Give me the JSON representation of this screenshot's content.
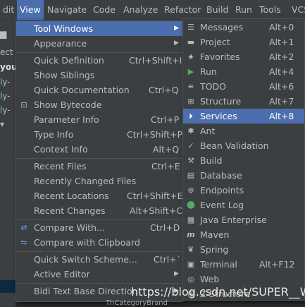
{
  "menubar": {
    "items": [
      {
        "label": "dit",
        "active": false
      },
      {
        "label": "View",
        "active": true
      },
      {
        "label": "Navigate",
        "active": false
      },
      {
        "label": "Code",
        "active": false
      },
      {
        "label": "Analyze",
        "active": false
      },
      {
        "label": "Refactor",
        "active": false
      },
      {
        "label": "Build",
        "active": false
      },
      {
        "label": "Run",
        "active": false
      },
      {
        "label": "Tools",
        "active": false
      },
      {
        "label": "VCS",
        "active": false
      }
    ]
  },
  "leftpane": {
    "texts": [
      "ect",
      "you",
      "ly-",
      "ly-",
      "ly-"
    ]
  },
  "view_menu": {
    "items": [
      {
        "label": "Tool Windows",
        "shortcut": "",
        "submenu": true,
        "selected": true
      },
      {
        "label": "Appearance",
        "shortcut": "",
        "submenu": true
      },
      {
        "sep": true
      },
      {
        "label": "Quick Definition",
        "shortcut": "Ctrl+Shift+I"
      },
      {
        "label": "Show Siblings",
        "shortcut": ""
      },
      {
        "label": "Quick Documentation",
        "shortcut": "Ctrl+Q"
      },
      {
        "label": "Show Bytecode",
        "shortcut": "",
        "icon": "bytecode-icon"
      },
      {
        "label": "Parameter Info",
        "shortcut": "Ctrl+P"
      },
      {
        "label": "Type Info",
        "shortcut": "Ctrl+Shift+P"
      },
      {
        "label": "Context Info",
        "shortcut": "Alt+Q"
      },
      {
        "sep": true
      },
      {
        "label": "Recent Files",
        "shortcut": "Ctrl+E"
      },
      {
        "label": "Recently Changed Files",
        "shortcut": ""
      },
      {
        "label": "Recent Locations",
        "shortcut": "Ctrl+Shift+E"
      },
      {
        "label": "Recent Changes",
        "shortcut": "Alt+Shift+C"
      },
      {
        "sep": true
      },
      {
        "label": "Compare With...",
        "shortcut": "Ctrl+D",
        "icon": "compare-icon"
      },
      {
        "label": "Compare with Clipboard",
        "shortcut": "",
        "icon": "compare-clipboard-icon"
      },
      {
        "sep": true
      },
      {
        "label": "Quick Switch Scheme...",
        "shortcut": "Ctrl+`"
      },
      {
        "label": "Active Editor",
        "shortcut": "",
        "submenu": true
      },
      {
        "sep": true
      },
      {
        "label": "Bidi Text Base Direction",
        "shortcut": "",
        "submenu": true
      }
    ]
  },
  "tool_windows_menu": {
    "items": [
      {
        "label": "Messages",
        "shortcut": "Alt+0",
        "icon": "messages-icon"
      },
      {
        "label": "Project",
        "shortcut": "Alt+1",
        "icon": "folder-icon"
      },
      {
        "label": "Favorites",
        "shortcut": "Alt+2",
        "icon": "star-icon"
      },
      {
        "label": "Run",
        "shortcut": "Alt+4",
        "icon": "run-icon"
      },
      {
        "label": "TODO",
        "shortcut": "Alt+6",
        "icon": "todo-icon"
      },
      {
        "label": "Structure",
        "shortcut": "Alt+7",
        "icon": "structure-icon"
      },
      {
        "label": "Services",
        "shortcut": "Alt+8",
        "icon": "services-icon",
        "selected": true
      },
      {
        "label": "Ant",
        "shortcut": "",
        "icon": "ant-icon"
      },
      {
        "label": "Bean Validation",
        "shortcut": "",
        "icon": "bean-validation-icon"
      },
      {
        "label": "Build",
        "shortcut": "",
        "icon": "hammer-icon"
      },
      {
        "label": "Database",
        "shortcut": "",
        "icon": "database-icon"
      },
      {
        "label": "Endpoints",
        "shortcut": "",
        "icon": "endpoints-icon"
      },
      {
        "label": "Event Log",
        "shortcut": "",
        "icon": "event-log-icon"
      },
      {
        "label": "Java Enterprise",
        "shortcut": "",
        "icon": "java-enterprise-icon"
      },
      {
        "label": "Maven",
        "shortcut": "",
        "icon": "maven-icon"
      },
      {
        "label": "Spring",
        "shortcut": "",
        "icon": "spring-icon"
      },
      {
        "label": "Terminal",
        "shortcut": "Alt+F12",
        "icon": "terminal-icon"
      },
      {
        "label": "Web",
        "shortcut": "",
        "icon": "web-icon"
      },
      {
        "label": "Z-Structure",
        "shortcut": "",
        "icon": "structure-icon"
      }
    ]
  },
  "watermark": "https://blog.csdn.net/SUPER__W",
  "bottom_text": "ThCategoryBrand"
}
